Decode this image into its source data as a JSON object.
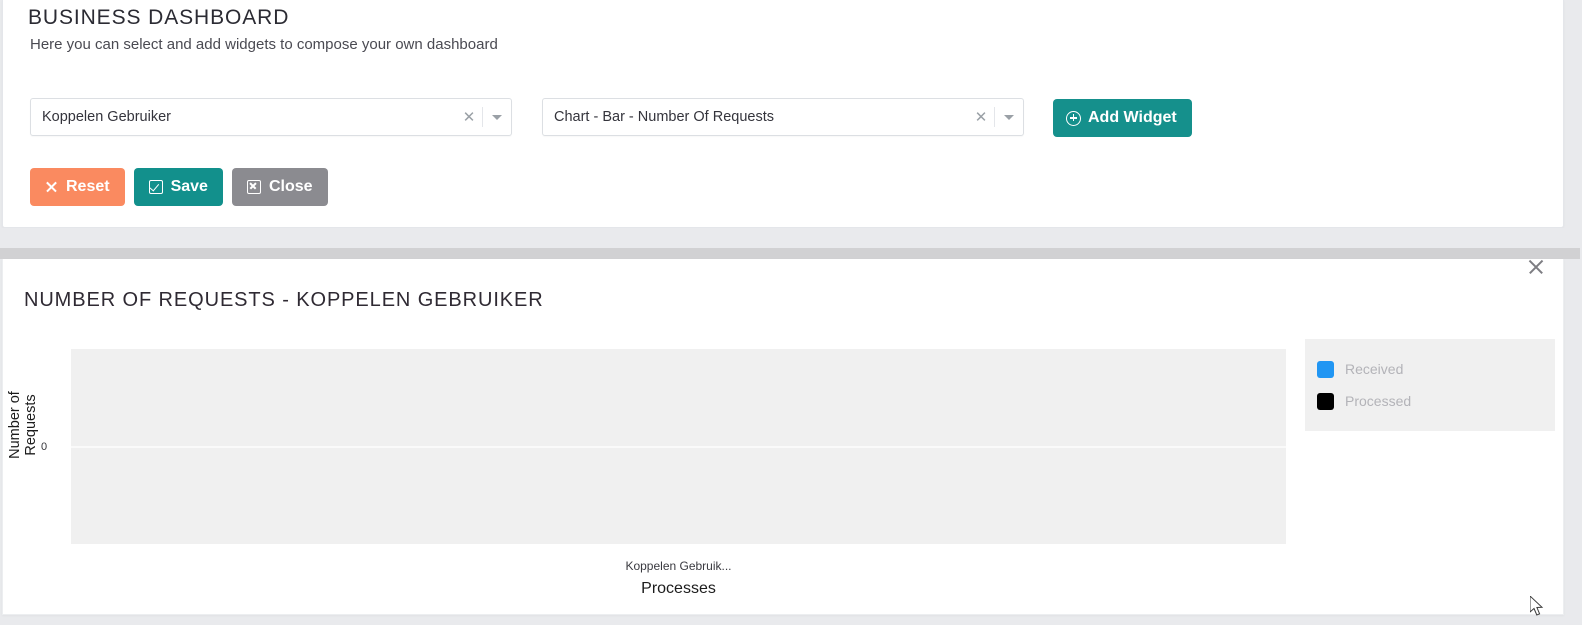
{
  "header": {
    "title": "BUSINESS DASHBOARD",
    "subtitle": "Here you can select and add widgets to compose your own dashboard"
  },
  "selects": [
    {
      "name": "process-select",
      "value": "Koppelen Gebruiker",
      "clear_icon": "x-icon",
      "caret_icon": "chevron-down-icon"
    },
    {
      "name": "widget-select",
      "value": "Chart - Bar - Number Of Requests",
      "clear_icon": "x-icon",
      "caret_icon": "chevron-down-icon"
    }
  ],
  "toolbar": {
    "add_widget_label": "Add Widget",
    "add_widget_icon": "plus-circle-icon",
    "add_widget_color": "#15908c"
  },
  "actions": [
    {
      "name": "reset-button",
      "label": "Reset",
      "icon": "x-icon",
      "color": "#fa8a60"
    },
    {
      "name": "save-button",
      "label": "Save",
      "icon": "check-square-icon",
      "color": "#12908c"
    },
    {
      "name": "close-button",
      "label": "Close",
      "icon": "x-square-icon",
      "color": "#8b8b90"
    }
  ],
  "widget": {
    "title": "NUMBER OF REQUESTS - KOPPELEN GEBRUIKER",
    "close_icon": "close-icon"
  },
  "chart_data": {
    "type": "bar",
    "title": "NUMBER OF REQUESTS - KOPPELEN GEBRUIKER",
    "xlabel": "Processes",
    "ylabel": "Number of Requests",
    "categories": [
      "Koppelen Gebruik..."
    ],
    "series": [
      {
        "name": "Received",
        "color": "#2196f3",
        "values": [
          0
        ]
      },
      {
        "name": "Processed",
        "color": "#000000",
        "values": [
          0
        ]
      }
    ],
    "yticks": [
      "0"
    ],
    "ylim": [
      -1,
      1
    ],
    "grid": true,
    "legend_position": "right",
    "legend_entries": [
      {
        "label": "Received",
        "color": "#2196f3"
      },
      {
        "label": "Processed",
        "color": "#000000"
      }
    ]
  }
}
